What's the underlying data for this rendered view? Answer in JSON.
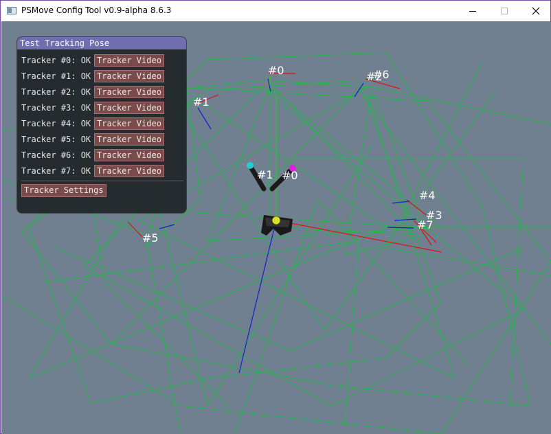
{
  "window": {
    "title": "PSMove Config Tool v0.9-alpha 8.6.3"
  },
  "panel": {
    "title": "Test Tracking Pose",
    "trackers": [
      {
        "label": "Tracker #0: OK",
        "button": "Tracker Video"
      },
      {
        "label": "Tracker #1: OK",
        "button": "Tracker Video"
      },
      {
        "label": "Tracker #2: OK",
        "button": "Tracker Video"
      },
      {
        "label": "Tracker #3: OK",
        "button": "Tracker Video"
      },
      {
        "label": "Tracker #4: OK",
        "button": "Tracker Video"
      },
      {
        "label": "Tracker #5: OK",
        "button": "Tracker Video"
      },
      {
        "label": "Tracker #6: OK",
        "button": "Tracker Video"
      },
      {
        "label": "Tracker #7: OK",
        "button": "Tracker Video"
      }
    ],
    "settings_button": "Tracker Settings"
  },
  "scene": {
    "tracker_labels": [
      "#0",
      "#1",
      "#2",
      "#6",
      "#4",
      "#3",
      "#7",
      "#5"
    ],
    "controller_labels": [
      "#1",
      "#0"
    ],
    "colors": {
      "background": "#708090",
      "frustum_lines": "#22b84a",
      "axis_x": "#e01010",
      "axis_y": "#22d022",
      "axis_z": "#1020d0",
      "controller_0_bulb": "#e020e0",
      "controller_1_bulb": "#20d0d0",
      "hmd_marker": "#d8e020"
    }
  },
  "icons": {
    "app": "app-window-icon",
    "minimize": "minimize-icon",
    "maximize": "maximize-icon",
    "close": "close-icon"
  }
}
